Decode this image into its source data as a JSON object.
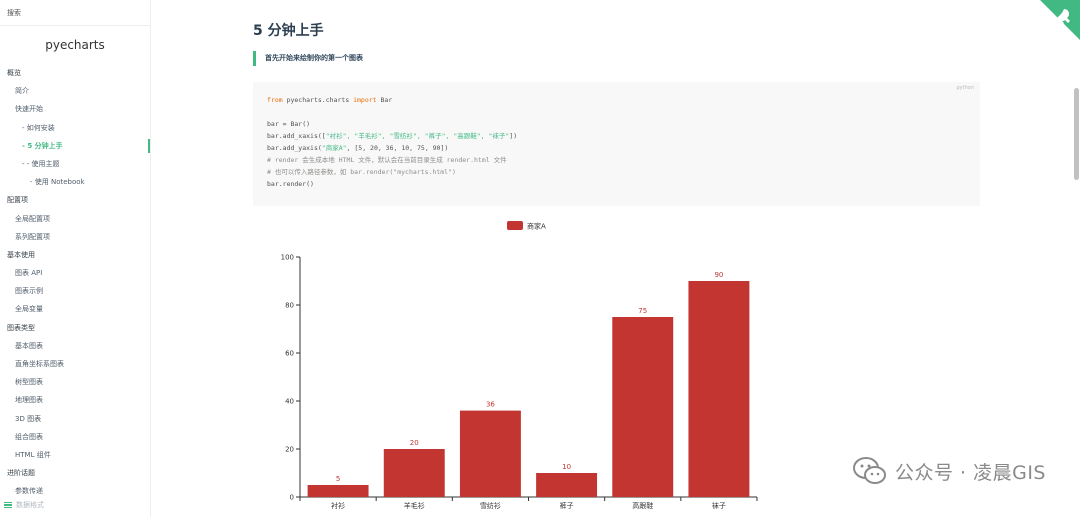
{
  "sidebar": {
    "search_label": "搜索",
    "brand": "pyecharts",
    "items": [
      {
        "label": "概览",
        "level": 0,
        "active": false
      },
      {
        "label": "简介",
        "level": 1,
        "active": false
      },
      {
        "label": "快速开始",
        "level": 1,
        "active": false
      },
      {
        "label": "- 如何安装",
        "level": 2,
        "active": false
      },
      {
        "label": "- 5 分钟上手",
        "level": 2,
        "active": true
      },
      {
        "label": "- - 使用主题",
        "level": 2,
        "active": false
      },
      {
        "label": "- 使用 Notebook",
        "level": 3,
        "active": false
      },
      {
        "label": "配置项",
        "level": 0,
        "active": false
      },
      {
        "label": "全局配置项",
        "level": 1,
        "active": false
      },
      {
        "label": "系列配置项",
        "level": 1,
        "active": false
      },
      {
        "label": "基本使用",
        "level": 0,
        "active": false
      },
      {
        "label": "图表 API",
        "level": 1,
        "active": false
      },
      {
        "label": "图表示例",
        "level": 1,
        "active": false
      },
      {
        "label": "全局变量",
        "level": 1,
        "active": false
      },
      {
        "label": "图表类型",
        "level": 0,
        "active": false
      },
      {
        "label": "基本图表",
        "level": 1,
        "active": false
      },
      {
        "label": "直角坐标系图表",
        "level": 1,
        "active": false
      },
      {
        "label": "树型图表",
        "level": 1,
        "active": false
      },
      {
        "label": "地理图表",
        "level": 1,
        "active": false
      },
      {
        "label": "3D 图表",
        "level": 1,
        "active": false
      },
      {
        "label": "组合图表",
        "level": 1,
        "active": false
      },
      {
        "label": "HTML 组件",
        "level": 1,
        "active": false
      },
      {
        "label": "进阶话题",
        "level": 0,
        "active": false
      },
      {
        "label": "参数传递",
        "level": 1,
        "active": false
      }
    ],
    "menu_label": "数据格式"
  },
  "content": {
    "title": "5 分钟上手",
    "tip": "首先开始来绘制你的第一个图表",
    "code_lang": "python",
    "code": {
      "l1_kw1": "from",
      "l1_mid": " pyecharts.charts ",
      "l1_kw2": "import",
      "l1_end": " Bar",
      "l3": "bar = Bar()",
      "l4_a": "bar.add_xaxis([",
      "l4_s": "\"衬衫\", \"羊毛衫\", \"雪纺衫\", \"裤子\", \"高跟鞋\", \"袜子\"",
      "l4_b": "])",
      "l5_a": "bar.add_yaxis(",
      "l5_s": "\"商家A\"",
      "l5_b": ", [5, 20, 36, 10, 75, 90])",
      "l6": "# render 会生成本地 HTML 文件，默认会在当前目录生成 render.html 文件",
      "l7": "# 也可以传入路径参数，如 bar.render(\"mycharts.html\")",
      "l8": "bar.render()"
    }
  },
  "watermark": "公众号 · 凌晨GIS",
  "colors": {
    "accent": "#42b983",
    "bar": "#c23531",
    "corner": "#42b983"
  },
  "icons": {
    "corner": "github-corner-icon",
    "menu": "menu-icon",
    "watermark": "wechat-icon"
  },
  "chart_data": {
    "type": "bar",
    "categories": [
      "衬衫",
      "羊毛衫",
      "雪纺衫",
      "裤子",
      "高跟鞋",
      "袜子"
    ],
    "series": [
      {
        "name": "商家A",
        "values": [
          5,
          20,
          36,
          10,
          75,
          90
        ]
      }
    ],
    "yticks": [
      "0",
      "20",
      "40",
      "60",
      "80",
      "100"
    ],
    "ylim": [
      0,
      100
    ],
    "legend": "top-center",
    "grid": false,
    "data_labels": true
  }
}
